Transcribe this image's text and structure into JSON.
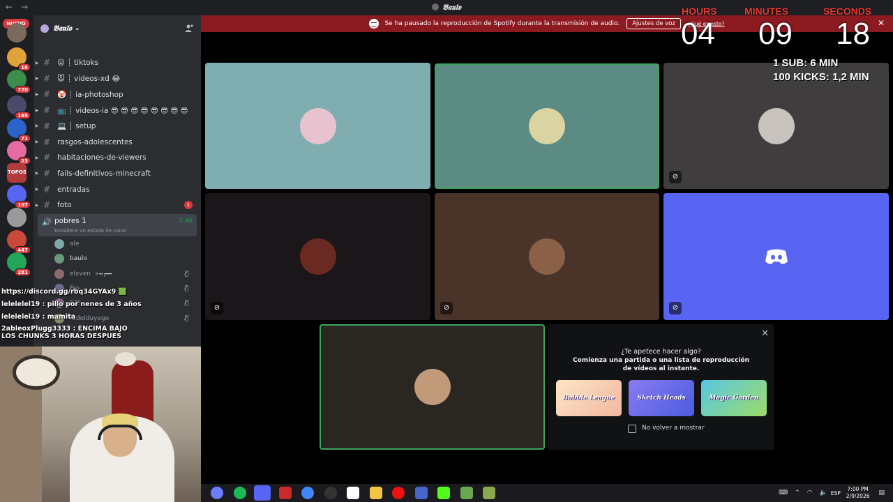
{
  "window": {
    "title": "𝕭𝖆𝖚𝖑𝖔",
    "back_icon": "←",
    "forward_icon": "→"
  },
  "rail": {
    "new_label": "NUEVO",
    "servers": [
      {
        "badge": "",
        "color": "#7a6a5c"
      },
      {
        "badge": "16",
        "color": "#e0a33a"
      },
      {
        "badge": "720",
        "color": "#3c8d4c"
      },
      {
        "badge": "165",
        "color": "#4a4a6a"
      },
      {
        "badge": "71",
        "color": "#2a63c9"
      },
      {
        "badge": "23",
        "color": "#e56ba1"
      },
      {
        "badge": "",
        "color": "#b33a3a"
      },
      {
        "badge": "107",
        "color": "#5865f2"
      },
      {
        "badge": "",
        "color": "#9a9a9a"
      },
      {
        "badge": "447",
        "color": "#c94a3b"
      },
      {
        "badge": "281",
        "color": "#23a55a"
      }
    ],
    "topos_label": "TOPOS"
  },
  "server": {
    "name": "𝕭𝖆𝖚𝖑𝖔",
    "chevron": "⌄"
  },
  "channels": [
    {
      "label": "😛 ┊ tiktoks",
      "badge": ""
    },
    {
      "label": "🐭 ┊ videos-xd 😂",
      "badge": ""
    },
    {
      "label": "🤡 ┊ ia-photoshop",
      "badge": ""
    },
    {
      "label": "📺 ┊ videos-ia 😎 😎 😎 😎 😎 😎 😎 😎",
      "badge": ""
    },
    {
      "label": "💻 ┊ setup",
      "badge": ""
    },
    {
      "label": "rasgos-adolescentes",
      "badge": ""
    },
    {
      "label": "habitaciones-de-viewers",
      "badge": ""
    },
    {
      "label": "fails-definitivos-minecraft",
      "badge": ""
    },
    {
      "label": "entradas",
      "badge": ""
    },
    {
      "label": "foto",
      "badge": "1"
    }
  ],
  "voice_channel": {
    "name": "pobres 1",
    "time": "1:00",
    "status": "Establece un estado de canal"
  },
  "members": [
    {
      "name": "ale",
      "color": "#7fa8a8"
    },
    {
      "name": "baulo",
      "color": "#6a9a7a"
    },
    {
      "name": "elxven",
      "color": "#8a6a6a"
    },
    {
      "name": "Fro",
      "color": "#6a6a8a"
    },
    {
      "name": "F2F",
      "color": "#8a6a8a"
    },
    {
      "name": "fudolduyego",
      "color": "#8a8a6a"
    }
  ],
  "member_badge": "✧↔┍━━",
  "chat_overlay": [
    "https://discord.gg/rbq34GYAx9 🟩",
    "lelelelel19 : pillo por nenes de 3 años",
    "lelelelel19 : mamita",
    "2ableoxPlugg3333 : ENCIMA BAJO LOS CHUNKS 3 HORAS DESPUES"
  ],
  "banner": {
    "text": "Se ha pausado la reproducción de Spotify durante la transmisión de audio.",
    "button": "Ajustes de voz",
    "link": "¿Qué es esto?",
    "close": "✕"
  },
  "timer": {
    "hours_label": "HOURS",
    "minutes_label": "MINUTES",
    "seconds_label": "SECONDS",
    "hours": "04",
    "minutes": "09",
    "seconds": "18",
    "rule1": "1 SUB: 6 MIN",
    "rule2": "100 KICKS: 1,2 MIN"
  },
  "tiles": [
    {
      "bg": "#7fadb0",
      "avatar": "#e7c2cf"
    },
    {
      "bg": "#5b8b83",
      "avatar": "#d9d4a2"
    },
    {
      "bg": "#403d3e",
      "avatar": "#c9c3bf"
    },
    {
      "bg": "#1b1619",
      "avatar": "#6a2a22"
    },
    {
      "bg": "#4a3328",
      "avatar": "#8a6047"
    },
    {
      "bg": "#5865f2",
      "avatar": ""
    },
    {
      "bg": "#2a2622",
      "avatar": "#c19a7a"
    }
  ],
  "activity": {
    "question": "¿Te apetece hacer algo?",
    "subtitle": "Comienza una partida o una lista de reproducción de vídeos al instante.",
    "games": [
      "Bobble League",
      "Sketch Heads",
      "Magic Garden"
    ],
    "checkbox_label": "No volver a mostrar",
    "close": "✕"
  },
  "taskbar": {
    "time": "7:00 PM",
    "date": "2/9/2026",
    "language": "ESP"
  }
}
